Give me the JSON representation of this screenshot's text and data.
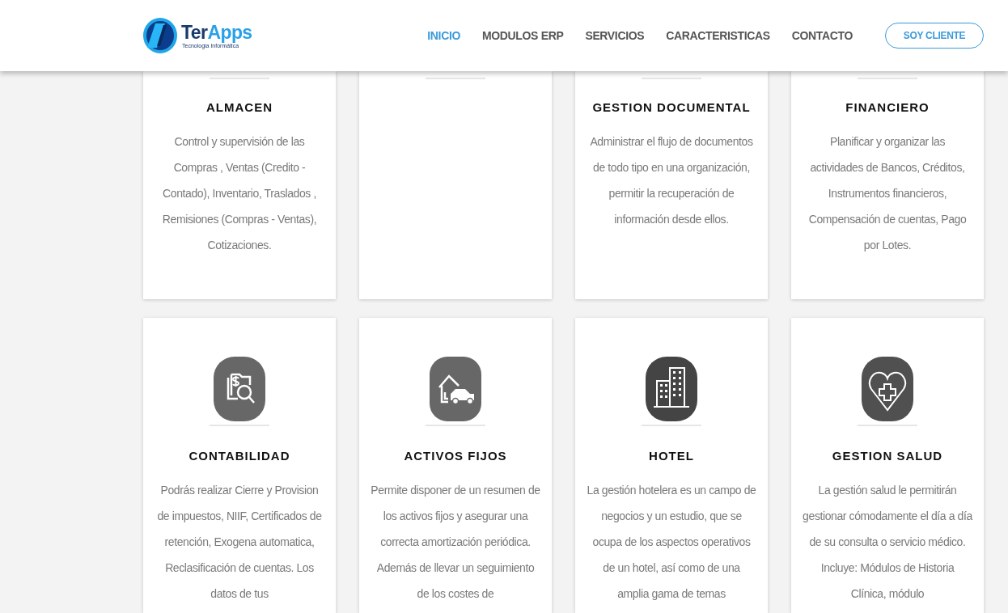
{
  "header": {
    "logo": {
      "name_parts": [
        "Ter",
        "Apps"
      ],
      "tagline": "Tecnologia Informática"
    },
    "nav": [
      {
        "label": "INICIO",
        "selected": true
      },
      {
        "label": "MODULOS ERP",
        "selected": false
      },
      {
        "label": "SERVICIOS",
        "selected": false
      },
      {
        "label": "CARACTERISTICAS",
        "selected": false
      },
      {
        "label": "CONTACTO",
        "selected": false
      }
    ],
    "client_button": "SOY CLIENTE"
  },
  "top_cards": [
    {
      "kind": "text",
      "title": "ALMACEN",
      "description": "Control y supervisión de las Compras , Ventas (Credito - Contado), Inventario, Traslados , Remisiones (Compras - Ventas), Cotizaciones."
    },
    {
      "kind": "blank"
    },
    {
      "kind": "text",
      "title": "GESTION DOCUMENTAL",
      "description": "Administrar el flujo de documentos de todo tipo en una organización, permitir la recuperación de información desde ellos."
    },
    {
      "kind": "text",
      "title": "FINANCIERO",
      "description": "Planificar y organizar las actividades de Bancos, Créditos, Instrumentos financieros, Compensación de cuentas, Pago por Lotes."
    }
  ],
  "modules": [
    {
      "title": "CONTABILIDAD",
      "description": "Podrás realizar Cierre y Provision de impuestos, NIIF, Certificados de retención, Exogena automatica, Reclasificación de cuentas. Los datos de tus"
    },
    {
      "title": "ACTIVOS FIJOS",
      "description": "Permite disponer de un resumen de los activos fijos y asegurar una correcta amortización periódica. Además de llevar un seguimiento de los costes de"
    },
    {
      "title": "HOTEL",
      "description": "La gestión hotelera es un campo de negocios y un estudio, que se ocupa de los aspectos operativos de un hotel, así como de una amplia gama de temas"
    },
    {
      "title": "GESTION SALUD",
      "description": "La gestión salud le permitirán gestionar cómodamente el día a día de su consulta o servicio médico. Incluye: Módulos de Historia Clínica, módulo"
    }
  ]
}
